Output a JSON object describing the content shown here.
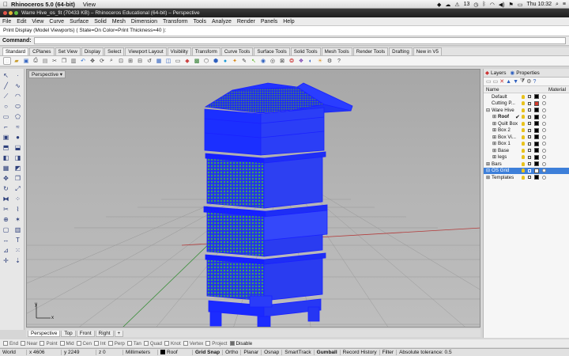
{
  "mac_menubar": {
    "app_name": "Rhinoceros 5.0 (64-bit)",
    "menus": [
      "View"
    ],
    "status_count": "13",
    "clock": "Thu 10:32"
  },
  "window": {
    "title": "Warre Hive_os_fit (70433 KB) – Rhinoceros Educational (64-bit) – Perspective"
  },
  "app_menu": [
    "File",
    "Edit",
    "View",
    "Curve",
    "Surface",
    "Solid",
    "Mesh",
    "Dimension",
    "Transform",
    "Tools",
    "Analyze",
    "Render",
    "Panels",
    "Help"
  ],
  "command_history": "Print Display (Model Viewports) ( State=On  Color=Print  Thickness=40 ):",
  "command": {
    "label": "Command:",
    "value": ""
  },
  "toolbar_tabs": [
    "Standard",
    "CPlanes",
    "Set View",
    "Display",
    "Select",
    "Viewport Layout",
    "Visibility",
    "Transform",
    "Curve Tools",
    "Surface Tools",
    "Solid Tools",
    "Mesh Tools",
    "Render Tools",
    "Drafting",
    "New in V5"
  ],
  "active_toolbar_tab": "Standard",
  "viewport": {
    "label": "Perspective",
    "tabs": [
      "Perspective",
      "Top",
      "Front",
      "Right"
    ],
    "active_tab": "Perspective",
    "add_tab": "+",
    "axis_x": "x",
    "axis_y": "y"
  },
  "osnap": {
    "items": [
      {
        "label": "End",
        "checked": false
      },
      {
        "label": "Near",
        "checked": false
      },
      {
        "label": "Point",
        "checked": false
      },
      {
        "label": "Mid",
        "checked": false
      },
      {
        "label": "Cen",
        "checked": false
      },
      {
        "label": "Int",
        "checked": false
      },
      {
        "label": "Perp",
        "checked": false
      },
      {
        "label": "Tan",
        "checked": false
      },
      {
        "label": "Quad",
        "checked": false
      },
      {
        "label": "Knot",
        "checked": false
      },
      {
        "label": "Vertex",
        "checked": false
      },
      {
        "label": "Project",
        "checked": false
      }
    ],
    "disable": {
      "label": "Disable",
      "checked": true
    }
  },
  "status_bar": {
    "world": "World",
    "x": "x 4606",
    "y": "y 2249",
    "z": "z 0",
    "units": "Millimeters",
    "layer": "Roof",
    "grid_snap": "Grid Snap",
    "ortho": "Ortho",
    "planar": "Planar",
    "osnap": "Osnap",
    "smarttrack": "SmartTrack",
    "gumball": "Gumball",
    "record_history": "Record History",
    "filter": "Filter",
    "tolerance": "Absolute tolerance: 0.5"
  },
  "panel": {
    "tabs": [
      {
        "label": "Layers",
        "icon": "layers-icon",
        "active": true
      },
      {
        "label": "Properties",
        "icon": "properties-icon",
        "active": false
      }
    ],
    "col_name": "Name",
    "col_material": "Material",
    "layers": [
      {
        "name": "Default",
        "indent": 0,
        "expander": "",
        "color": "#000000",
        "current": false,
        "selected": false
      },
      {
        "name": "Cutting P...",
        "indent": 0,
        "expander": "",
        "color": "#d43a2a",
        "current": false,
        "selected": false
      },
      {
        "name": "Ware Hive",
        "indent": 0,
        "expander": "⊟",
        "color": "#000000",
        "current": false,
        "selected": false
      },
      {
        "name": "Roof",
        "indent": 1,
        "expander": "⊞",
        "color": "#000000",
        "current": true,
        "selected": false
      },
      {
        "name": "Quilt Box",
        "indent": 1,
        "expander": "⊞",
        "color": "#000000",
        "current": false,
        "selected": false
      },
      {
        "name": "Box 2",
        "indent": 1,
        "expander": "⊞",
        "color": "#000000",
        "current": false,
        "selected": false
      },
      {
        "name": "Box Vi...",
        "indent": 1,
        "expander": "⊞",
        "color": "#000000",
        "current": false,
        "selected": false
      },
      {
        "name": "Box 1",
        "indent": 1,
        "expander": "⊞",
        "color": "#000000",
        "current": false,
        "selected": false
      },
      {
        "name": "Base",
        "indent": 1,
        "expander": "⊞",
        "color": "#000000",
        "current": false,
        "selected": false
      },
      {
        "name": "legs",
        "indent": 1,
        "expander": "⊞",
        "color": "#000000",
        "current": false,
        "selected": false
      },
      {
        "name": "Bars",
        "indent": 0,
        "expander": "⊞",
        "color": "#000000",
        "current": false,
        "selected": false
      },
      {
        "name": "OS Grid",
        "indent": 0,
        "expander": "⊟",
        "color": "#ffffff",
        "current": false,
        "selected": true
      },
      {
        "name": "Templates",
        "indent": 0,
        "expander": "⊞",
        "color": "#000000",
        "current": false,
        "selected": false
      }
    ]
  },
  "colors": {
    "selection": "#3d7fd9",
    "model_blue": "#1a2bff",
    "viewport_bg": "#b0b0b0"
  }
}
